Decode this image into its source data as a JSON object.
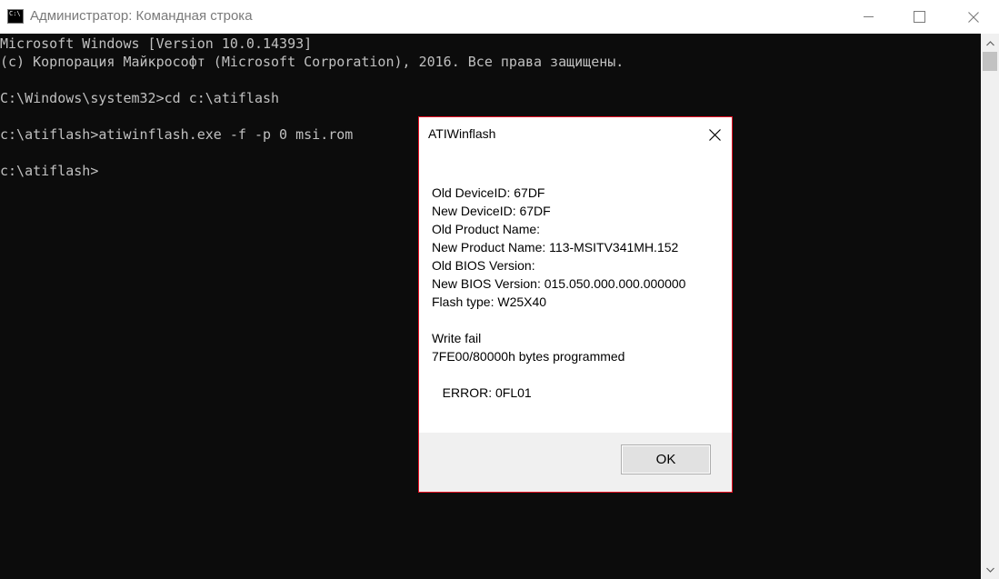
{
  "window": {
    "title": "Администратор: Командная строка",
    "icon": "cmd-icon",
    "icon_text": "C:\\"
  },
  "console": {
    "lines": [
      "Microsoft Windows [Version 10.0.14393]",
      "(c) Корпорация Майкрософт (Microsoft Corporation), 2016. Все права защищены.",
      "",
      "C:\\Windows\\system32>cd c:\\atiflash",
      "",
      "c:\\atiflash>atiwinflash.exe -f -p 0 msi.rom",
      "",
      "c:\\atiflash>"
    ]
  },
  "dialog": {
    "title": "ATIWinflash",
    "lines": [
      "Old DeviceID: 67DF",
      "New DeviceID: 67DF",
      "Old Product Name:",
      "New Product Name: 113-MSITV341MH.152",
      "Old BIOS Version:",
      "New BIOS Version: 015.050.000.000.000000",
      "Flash type: W25X40",
      "",
      "Write fail",
      "7FE00/80000h bytes programmed",
      "",
      "   ERROR: 0FL01"
    ],
    "ok_label": "OK"
  },
  "colors": {
    "console_bg": "#0c0c0c",
    "console_text": "#c0c0c0",
    "dialog_border": "#e81123"
  }
}
